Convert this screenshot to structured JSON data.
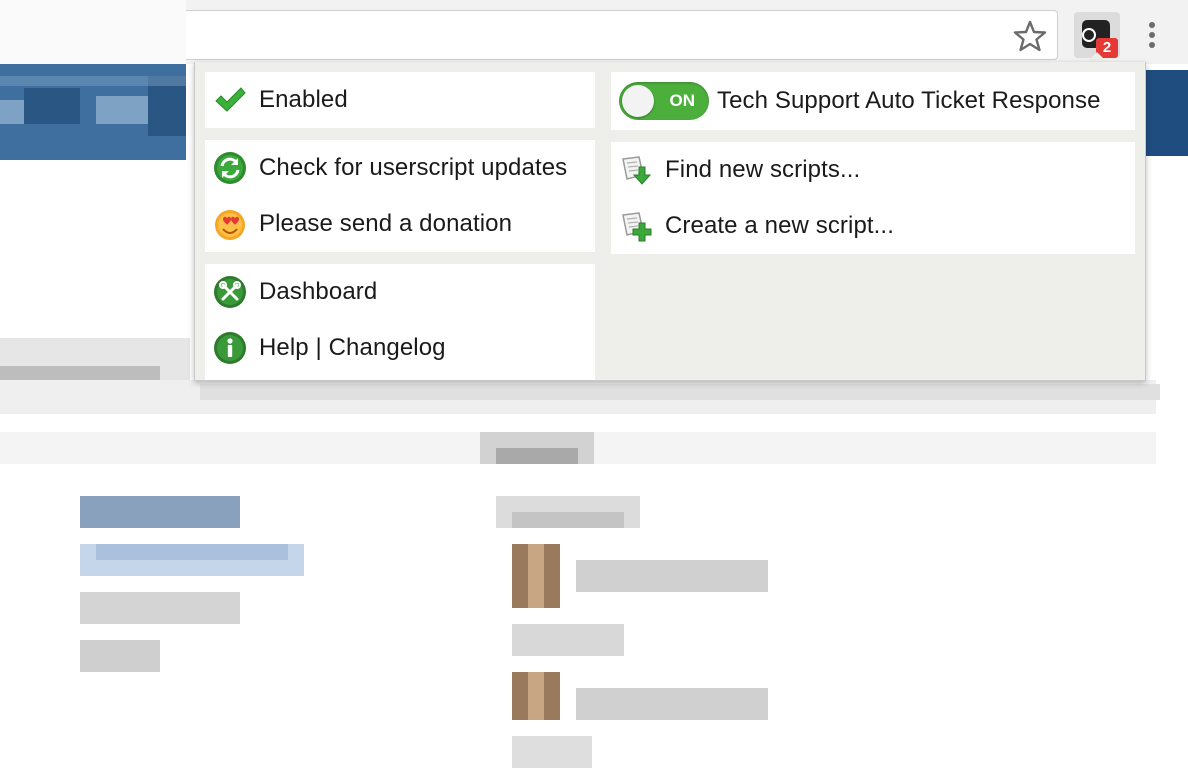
{
  "browser": {
    "badge_count": "2",
    "accent_badge": "#e53935"
  },
  "popup": {
    "enabled": {
      "label": "Enabled",
      "icon": "check-icon"
    },
    "toggle": {
      "state": "ON",
      "label": "Tech Support Auto Ticket Response",
      "color": "#4caf3c"
    },
    "group1": [
      {
        "label": "Check for userscript updates",
        "icon": "refresh-icon"
      },
      {
        "label": "Please send a donation",
        "icon": "heart-eyes-icon"
      }
    ],
    "group2": [
      {
        "label": "Find new scripts...",
        "icon": "download-script-icon"
      },
      {
        "label": "Create a new script...",
        "icon": "add-script-icon"
      }
    ],
    "group3": [
      {
        "label": "Dashboard",
        "icon": "tools-icon"
      },
      {
        "label": "Help | Changelog",
        "icon": "info-icon"
      }
    ]
  }
}
